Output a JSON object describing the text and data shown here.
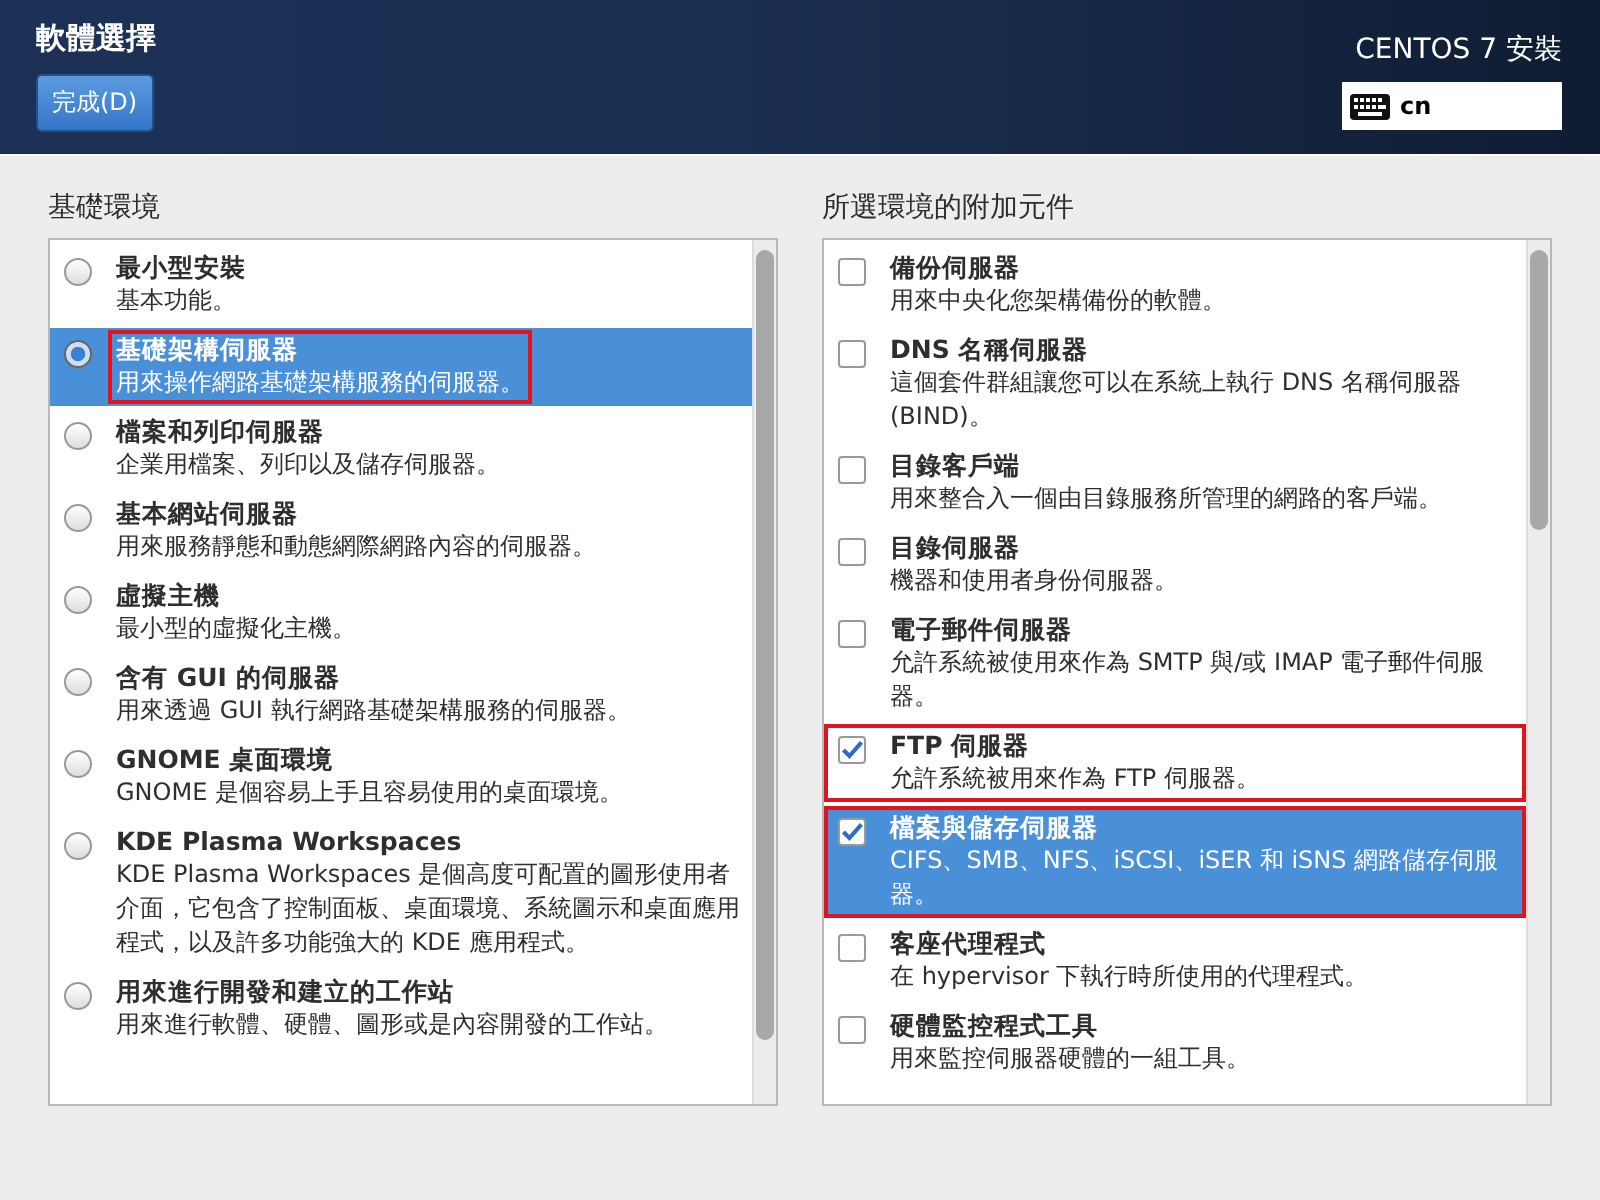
{
  "header": {
    "title": "軟體選擇",
    "done_button": "完成(D)",
    "product": "CENTOS 7 安裝",
    "keyboard_layout": "cn"
  },
  "base_environment": {
    "heading": "基礎環境",
    "items": [
      {
        "name": "最小型安裝",
        "description": "基本功能。",
        "selected": false,
        "highlighted": false
      },
      {
        "name": "基礎架構伺服器",
        "description": "用來操作網路基礎架構服務的伺服器。",
        "selected": true,
        "highlighted": true
      },
      {
        "name": "檔案和列印伺服器",
        "description": "企業用檔案、列印以及儲存伺服器。",
        "selected": false,
        "highlighted": false
      },
      {
        "name": "基本網站伺服器",
        "description": "用來服務靜態和動態網際網路內容的伺服器。",
        "selected": false,
        "highlighted": false
      },
      {
        "name": "虛擬主機",
        "description": "最小型的虛擬化主機。",
        "selected": false,
        "highlighted": false
      },
      {
        "name": "含有 GUI 的伺服器",
        "description": "用來透過 GUI 執行網路基礎架構服務的伺服器。",
        "selected": false,
        "highlighted": false
      },
      {
        "name": "GNOME 桌面環境",
        "description": "GNOME 是個容易上手且容易使用的桌面環境。",
        "selected": false,
        "highlighted": false
      },
      {
        "name": "KDE Plasma Workspaces",
        "description": "KDE Plasma Workspaces 是個高度可配置的圖形使用者介面，它包含了控制面板、桌面環境、系統圖示和桌面應用程式，以及許多功能強大的 KDE 應用程式。",
        "selected": false,
        "highlighted": false
      },
      {
        "name": "用來進行開發和建立的工作站",
        "description": "用來進行軟體、硬體、圖形或是內容開發的工作站。",
        "selected": false,
        "highlighted": false
      }
    ]
  },
  "addons": {
    "heading": "所選環境的附加元件",
    "items": [
      {
        "name": "備份伺服器",
        "description": "用來中央化您架構備份的軟體。",
        "checked": false,
        "selected": false,
        "highlighted": false
      },
      {
        "name": "DNS 名稱伺服器",
        "description": "這個套件群組讓您可以在系統上執行 DNS 名稱伺服器 (BIND)。",
        "checked": false,
        "selected": false,
        "highlighted": false
      },
      {
        "name": "目錄客戶端",
        "description": "用來整合入一個由目錄服務所管理的網路的客戶端。",
        "checked": false,
        "selected": false,
        "highlighted": false
      },
      {
        "name": "目錄伺服器",
        "description": "機器和使用者身份伺服器。",
        "checked": false,
        "selected": false,
        "highlighted": false
      },
      {
        "name": "電子郵件伺服器",
        "description": "允許系統被使用來作為 SMTP 與/或 IMAP 電子郵件伺服器。",
        "checked": false,
        "selected": false,
        "highlighted": false
      },
      {
        "name": "FTP 伺服器",
        "description": "允許系統被用來作為 FTP 伺服器。",
        "checked": true,
        "selected": false,
        "highlighted": true
      },
      {
        "name": "檔案與儲存伺服器",
        "description": "CIFS、SMB、NFS、iSCSI、iSER 和 iSNS 網路儲存伺服器。",
        "checked": true,
        "selected": true,
        "highlighted": true
      },
      {
        "name": "客座代理程式",
        "description": "在 hypervisor 下執行時所使用的代理程式。",
        "checked": false,
        "selected": false,
        "highlighted": false
      },
      {
        "name": "硬體監控程式工具",
        "description": "用來監控伺服器硬體的一組工具。",
        "checked": false,
        "selected": false,
        "highlighted": false
      }
    ]
  }
}
